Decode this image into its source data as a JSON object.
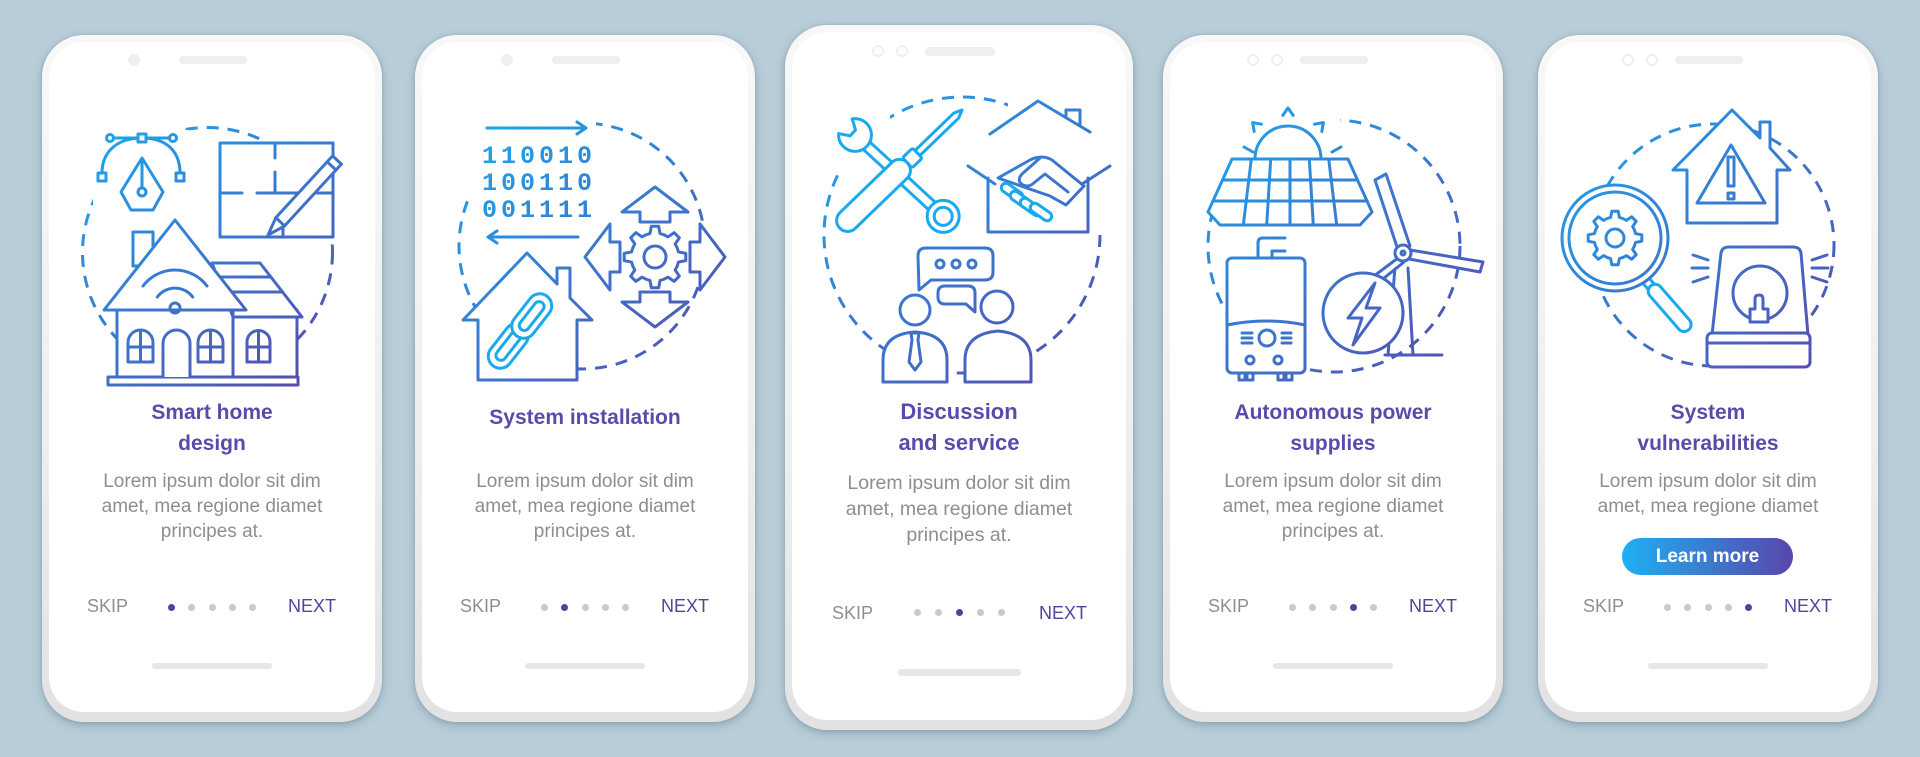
{
  "colors": {
    "background": "#b8cdd8",
    "title": "#5a4bab",
    "body_text": "#8e8e8e",
    "skip": "#8e8e8e",
    "next": "#4e4699",
    "dot_active": "#4e43a3",
    "dot_inactive": "#c9c9c9",
    "gradient_start": "#1aa9ef",
    "gradient_end": "#5a47ad",
    "button_start": "#1eb0f3",
    "button_end": "#5846ab"
  },
  "screens": [
    {
      "title_lines": [
        "Smart home",
        "design"
      ],
      "body_lines": [
        "Lorem ipsum dolor sit dim",
        "amet, mea regione diamet",
        "principes at."
      ],
      "skip": "SKIP",
      "next": "NEXT",
      "current_page": 1,
      "page_count": 5,
      "icons": [
        "pen-tool-icon",
        "floor-plan-icon",
        "pencil-icon",
        "smart-house-icon",
        "wifi-icon"
      ]
    },
    {
      "title_lines": [
        "System installation"
      ],
      "body_lines": [
        "Lorem ipsum dolor sit dim",
        "amet, mea regione diamet",
        "principes at."
      ],
      "skip": "SKIP",
      "next": "NEXT",
      "current_page": 2,
      "page_count": 5,
      "binary_rows": [
        "110010",
        "100110",
        "001111"
      ],
      "icons": [
        "arrow-right-icon",
        "binary-code-icon",
        "arrow-left-icon",
        "house-chain-icon",
        "gear-arrows-icon"
      ]
    },
    {
      "title_lines": [
        "Discussion",
        "and service"
      ],
      "body_lines": [
        "Lorem ipsum dolor sit dim",
        "amet, mea regione diamet",
        "principes at."
      ],
      "skip": "SKIP",
      "next": "NEXT",
      "current_page": 3,
      "page_count": 5,
      "icons": [
        "wrench-icon",
        "screwdriver-icon",
        "handshake-house-icon",
        "speech-bubble-icon",
        "people-icon"
      ]
    },
    {
      "title_lines": [
        "Autonomous power",
        "supplies"
      ],
      "body_lines": [
        "Lorem ipsum dolor sit dim",
        "amet, mea regione diamet",
        "principes at."
      ],
      "skip": "SKIP",
      "next": "NEXT",
      "current_page": 4,
      "page_count": 5,
      "icons": [
        "sun-icon",
        "solar-panel-icon",
        "boiler-icon",
        "wind-turbine-icon",
        "lightning-icon"
      ]
    },
    {
      "title_lines": [
        "System",
        "vulnerabilities"
      ],
      "body_lines": [
        "Lorem ipsum dolor sit dim",
        "amet, mea regione diamet"
      ],
      "button": "Learn more",
      "skip": "SKIP",
      "next": "NEXT",
      "current_page": 5,
      "page_count": 5,
      "icons": [
        "warning-house-icon",
        "magnifier-gear-icon",
        "alarm-siren-icon"
      ]
    }
  ]
}
